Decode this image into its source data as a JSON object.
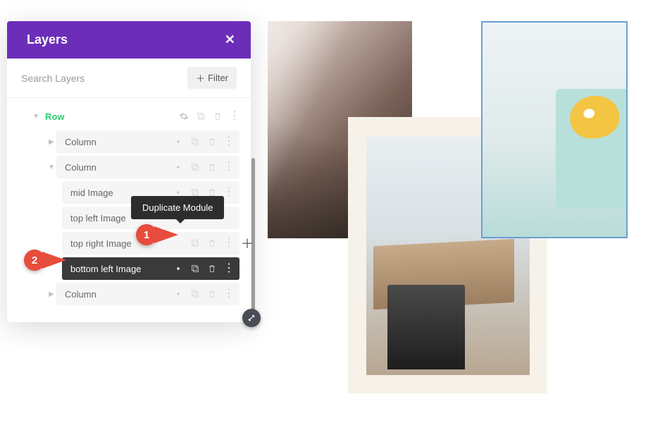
{
  "panel": {
    "title": "Layers",
    "search_placeholder": "Search Layers",
    "filter_label": "Filter"
  },
  "tree": {
    "row_label": "Row",
    "column1": "Column",
    "column2": "Column",
    "column3": "Column",
    "mid_image": "mid Image",
    "top_left": "top left Image",
    "top_right": "top right Image",
    "bottom_left": "bottom left Image"
  },
  "tooltip": "Duplicate Module",
  "annotations": {
    "one": "1",
    "two": "2"
  }
}
